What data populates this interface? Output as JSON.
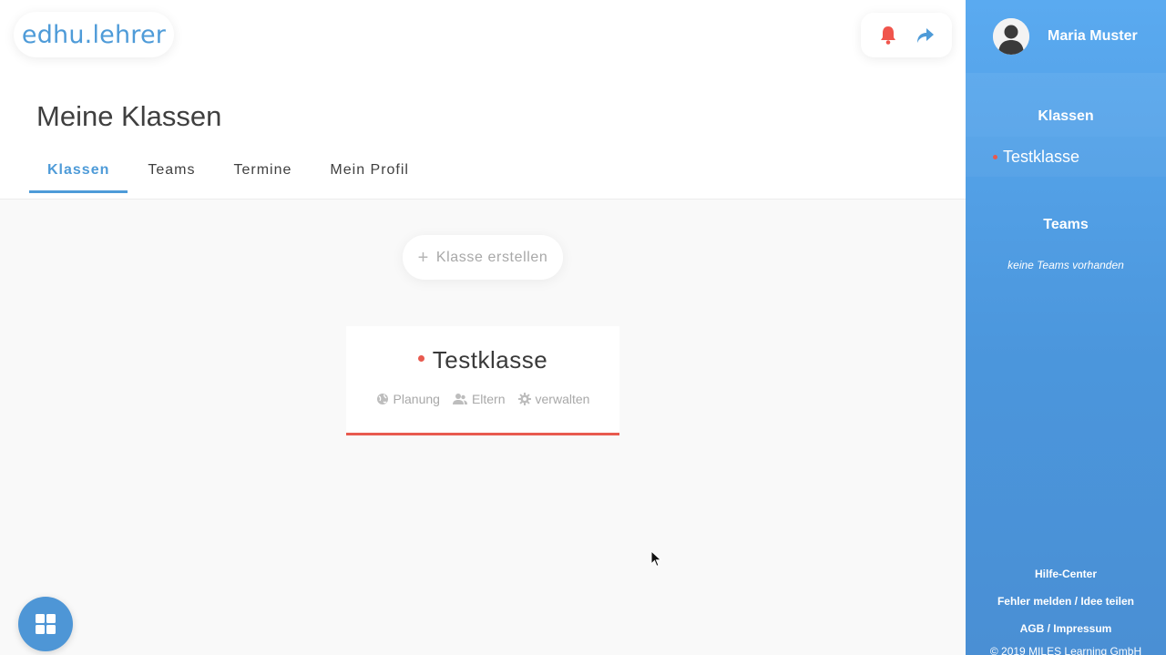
{
  "logo": {
    "text": "edhu.lehrer"
  },
  "header": {
    "title": "Meine Klassen",
    "tabs": [
      {
        "label": "Klassen",
        "active": true
      },
      {
        "label": "Teams",
        "active": false
      },
      {
        "label": "Termine",
        "active": false
      },
      {
        "label": "Mein Profil",
        "active": false
      }
    ]
  },
  "toolbar": {
    "notification_icon": "bell-icon",
    "logout_icon": "share-arrow-icon"
  },
  "main": {
    "create_button": {
      "plus": "+",
      "label": "Klasse erstellen"
    },
    "class_card": {
      "title": "Testklasse",
      "links": [
        {
          "label": "Planung",
          "icon": "globe-icon"
        },
        {
          "label": "Eltern",
          "icon": "users-icon"
        },
        {
          "label": "verwalten",
          "icon": "gear-icon"
        }
      ]
    }
  },
  "sidebar": {
    "user_name": "Maria Muster",
    "classes_title": "Klassen",
    "classes": [
      {
        "label": "Testklasse"
      }
    ],
    "teams_title": "Teams",
    "teams_empty": "keine Teams vorhanden",
    "footer": {
      "help": "Hilfe-Center",
      "report": "Fehler melden / Idee teilen",
      "agb": "AGB / Impressum",
      "copyright": "© 2019 MILES Learning GmbH"
    }
  },
  "colors": {
    "accent": "#4e9bd8",
    "alert": "#e85a4f",
    "sidebar": "#4e9bd8"
  }
}
